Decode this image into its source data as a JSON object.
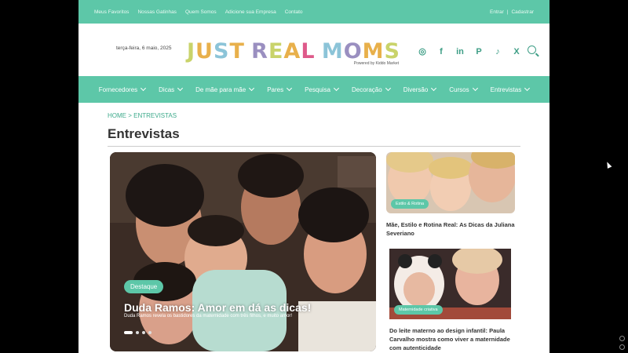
{
  "topbar": {
    "links": [
      "Meus Favoritos",
      "Nossas Gatinhas",
      "Quem Somos",
      "Adicione sua Empresa",
      "Contato"
    ],
    "login": "Entrar",
    "separator": "|",
    "register": "Cadastrar"
  },
  "header": {
    "date": "terça-feira, 6 maio, 2025",
    "logo_text": "JUST REAL MOMS",
    "logo_powered": "Powered by Kiddo Market",
    "social_icons": [
      "instagram-icon",
      "facebook-icon",
      "linkedin-icon",
      "pinterest-icon",
      "tiktok-icon",
      "x-icon"
    ],
    "social_glyphs": [
      "◎",
      "f",
      "in",
      "P",
      "♪",
      "X"
    ]
  },
  "nav": {
    "items": [
      "Fornecedores",
      "Dicas",
      "De mãe para mãe",
      "Pares",
      "Pesquisa",
      "Decoração",
      "Diversão",
      "Cursos",
      "Entrevistas"
    ]
  },
  "breadcrumb": "HOME > ENTREVISTAS",
  "page_title": "Entrevistas",
  "hero": {
    "badge": "Destaque",
    "title": "Duda Ramos: Amor em dá as dicas!",
    "subtitle": "Duda Ramos revela os bastidores da maternidade com três filhos, e muito amor!"
  },
  "cards": [
    {
      "tag": "Estilo & Rotina",
      "title": "Mãe, Estilo e Rotina Real: As Dicas da Juliana Severiano"
    },
    {
      "tag": "Maternidade criativa",
      "title": "Do leite materno ao design infantil: Paula Carvalho mostra como viver a maternidade com autenticidade"
    }
  ],
  "colors": {
    "accent": "#5dc7a8",
    "logo_letters": [
      "#c9d36a",
      "#e8b04b",
      "#8cc4d8",
      "#e8b04b",
      "#9a8fc0",
      "#c9d36a",
      "#e8b04b",
      "#de5a8a",
      "#8cc4d8",
      "#9a8fc0",
      "#e8b04b",
      "#c9d36a",
      "#8cc4d8",
      "#de5a8a"
    ]
  }
}
